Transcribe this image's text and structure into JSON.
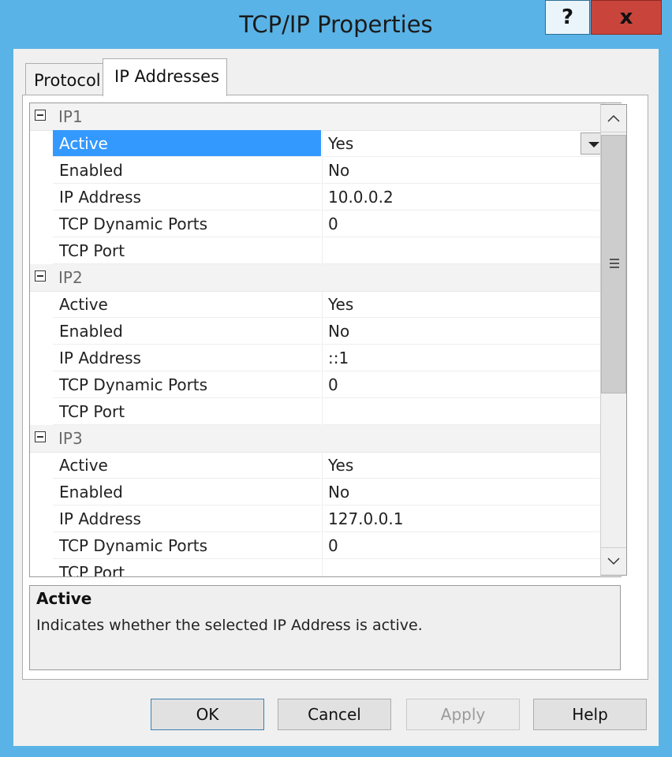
{
  "window": {
    "title": "TCP/IP Properties",
    "help_glyph": "?",
    "close_glyph": "x"
  },
  "tabs": [
    {
      "label": "Protocol"
    },
    {
      "label": "IP Addresses",
      "selected": true
    }
  ],
  "grid": {
    "selected_property": "IP1.Active",
    "categories": [
      {
        "name": "IP1",
        "properties": [
          {
            "name": "Active",
            "value": "Yes"
          },
          {
            "name": "Enabled",
            "value": "No"
          },
          {
            "name": "IP Address",
            "value": "10.0.0.2"
          },
          {
            "name": "TCP Dynamic Ports",
            "value": "0"
          },
          {
            "name": "TCP Port",
            "value": ""
          }
        ]
      },
      {
        "name": "IP2",
        "properties": [
          {
            "name": "Active",
            "value": "Yes"
          },
          {
            "name": "Enabled",
            "value": "No"
          },
          {
            "name": "IP Address",
            "value": "::1"
          },
          {
            "name": "TCP Dynamic Ports",
            "value": "0"
          },
          {
            "name": "TCP Port",
            "value": ""
          }
        ]
      },
      {
        "name": "IP3",
        "properties": [
          {
            "name": "Active",
            "value": "Yes"
          },
          {
            "name": "Enabled",
            "value": "No"
          },
          {
            "name": "IP Address",
            "value": "127.0.0.1"
          },
          {
            "name": "TCP Dynamic Ports",
            "value": "0"
          },
          {
            "name": "TCP Port",
            "value": ""
          }
        ]
      }
    ]
  },
  "description": {
    "title": "Active",
    "text": "Indicates whether the selected IP Address is active."
  },
  "buttons": {
    "ok": "OK",
    "cancel": "Cancel",
    "apply": "Apply",
    "help": "Help",
    "apply_enabled": false
  },
  "colors": {
    "selection": "#3399ff",
    "title_bar": "#5ab3e6",
    "close": "#c9443b"
  }
}
